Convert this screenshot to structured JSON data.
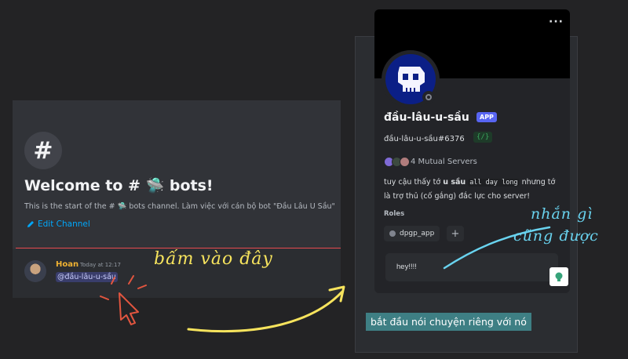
{
  "channel": {
    "hash_symbol": "#",
    "welcome_title": "Welcome to # 🛸 bots!",
    "welcome_subtitle": "This is the start of the # 🛸 bots channel. Làm việc với cán bộ bot \"Đầu Lâu U Sầu\"",
    "edit_channel_label": "Edit Channel"
  },
  "message": {
    "author": "Hoan",
    "time": "Today at 12:17",
    "mention": "@đầu-lâu-u-sầu"
  },
  "profile": {
    "more_label": "···",
    "display_name": "đầu-lâu-u-sầu",
    "app_badge": "APP",
    "username": "đầu-lâu-u-sầu#6376",
    "dev_badge": "{/}",
    "mutual_servers": "4 Mutual Servers",
    "about_part1": "tuy cậu thấy tớ ",
    "about_bold": "u sầu",
    "about_code": "all day long",
    "about_part2": " nhưng tớ là trợ thủ (cố gắng) đắc lực cho server!",
    "roles_label": "Roles",
    "role_name": "dpgp_app",
    "role_add": "+",
    "dm_value": "hey!!!!"
  },
  "caption": "bắt đầu nói chuyện riêng với nó",
  "annotations": {
    "yellow_text": "bấm vào đây",
    "blue_line1": "nhắn gì",
    "blue_line2": "cũng được"
  },
  "colors": {
    "accent_yellow": "#f6e35d",
    "accent_blue": "#69d3ef",
    "mention_bg": "#5865f2",
    "author_color": "#f0b232",
    "caption_bg": "#3e7f84"
  }
}
